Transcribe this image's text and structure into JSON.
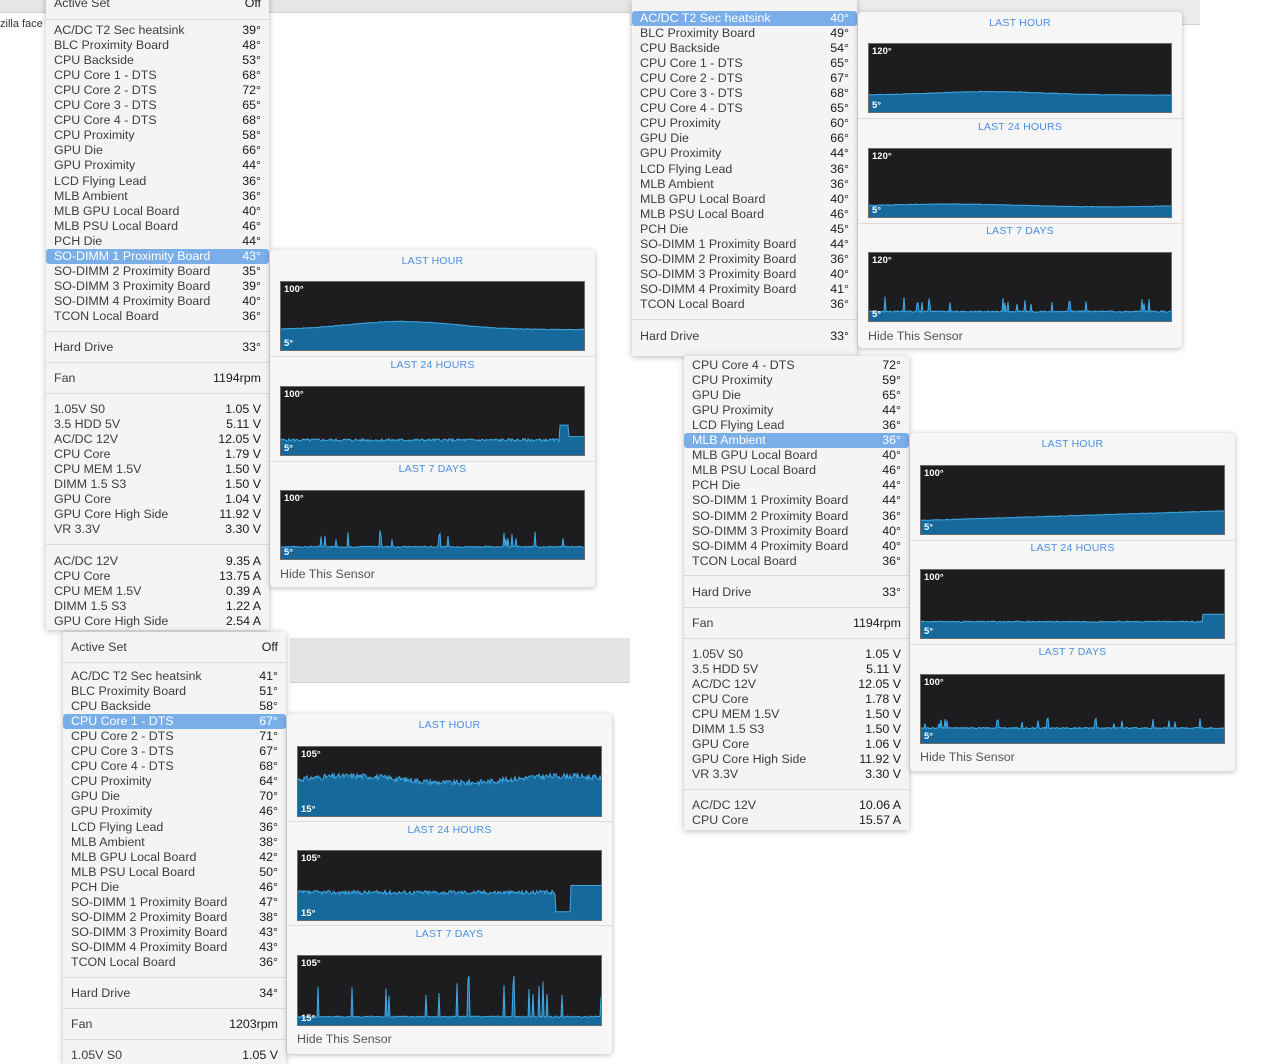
{
  "background": {
    "tab_fragment": "zilla face"
  },
  "menu_tl": {
    "header": {
      "label": "Active Set",
      "value": "Off"
    },
    "sensors": [
      {
        "label": "AC/DC T2 Sec heatsink",
        "value": "39°"
      },
      {
        "label": "BLC Proximity Board",
        "value": "48°"
      },
      {
        "label": "CPU Backside",
        "value": "53°"
      },
      {
        "label": "CPU Core 1 - DTS",
        "value": "68°"
      },
      {
        "label": "CPU Core 2 - DTS",
        "value": "72°"
      },
      {
        "label": "CPU Core 3 - DTS",
        "value": "65°"
      },
      {
        "label": "CPU Core 4 - DTS",
        "value": "68°"
      },
      {
        "label": "CPU Proximity",
        "value": "58°"
      },
      {
        "label": "GPU Die",
        "value": "66°"
      },
      {
        "label": "GPU Proximity",
        "value": "44°"
      },
      {
        "label": "LCD Flying Lead",
        "value": "36°"
      },
      {
        "label": "MLB Ambient",
        "value": "36°"
      },
      {
        "label": "MLB GPU Local Board",
        "value": "40°"
      },
      {
        "label": "MLB PSU Local Board",
        "value": "46°"
      },
      {
        "label": "PCH Die",
        "value": "44°"
      },
      {
        "label": "SO-DIMM 1 Proximity Board",
        "value": "43°"
      },
      {
        "label": "SO-DIMM 2 Proximity Board",
        "value": "35°"
      },
      {
        "label": "SO-DIMM 3 Proximity Board",
        "value": "39°"
      },
      {
        "label": "SO-DIMM 4 Proximity Board",
        "value": "40°"
      },
      {
        "label": "TCON Local Board",
        "value": "36°"
      }
    ],
    "drive": {
      "label": "Hard Drive",
      "value": "33°"
    },
    "fan": {
      "label": "Fan",
      "value": "1194rpm"
    },
    "voltages": [
      {
        "label": "1.05V S0",
        "value": "1.05 V"
      },
      {
        "label": "3.5 HDD 5V",
        "value": "5.11 V"
      },
      {
        "label": "AC/DC 12V",
        "value": "12.05 V"
      },
      {
        "label": "CPU Core",
        "value": "1.79 V"
      },
      {
        "label": "CPU MEM 1.5V",
        "value": "1.50 V"
      },
      {
        "label": "DIMM 1.5 S3",
        "value": "1.50 V"
      },
      {
        "label": "GPU Core",
        "value": "1.04 V"
      },
      {
        "label": "GPU Core High Side",
        "value": "11.92 V"
      },
      {
        "label": "VR 3.3V",
        "value": "3.30 V"
      }
    ],
    "currents": [
      {
        "label": "AC/DC 12V",
        "value": "9.35 A"
      },
      {
        "label": "CPU Core",
        "value": "13.75 A"
      },
      {
        "label": "CPU MEM 1.5V",
        "value": "0.39 A"
      },
      {
        "label": "DIMM 1.5 S3",
        "value": "1.22 A"
      },
      {
        "label": "GPU Core High Side",
        "value": "2.54 A"
      }
    ]
  },
  "menu_tr": {
    "sensors": [
      {
        "label": "AC/DC T2 Sec heatsink",
        "value": "40°"
      },
      {
        "label": "BLC Proximity Board",
        "value": "49°"
      },
      {
        "label": "CPU Backside",
        "value": "54°"
      },
      {
        "label": "CPU Core 1 - DTS",
        "value": "65°"
      },
      {
        "label": "CPU Core 2 - DTS",
        "value": "67°"
      },
      {
        "label": "CPU Core 3 - DTS",
        "value": "68°"
      },
      {
        "label": "CPU Core 4 - DTS",
        "value": "65°"
      },
      {
        "label": "CPU Proximity",
        "value": "60°"
      },
      {
        "label": "GPU Die",
        "value": "66°"
      },
      {
        "label": "GPU Proximity",
        "value": "44°"
      },
      {
        "label": "LCD Flying Lead",
        "value": "36°"
      },
      {
        "label": "MLB Ambient",
        "value": "36°"
      },
      {
        "label": "MLB GPU Local Board",
        "value": "40°"
      },
      {
        "label": "MLB PSU Local Board",
        "value": "46°"
      },
      {
        "label": "PCH Die",
        "value": "45°"
      },
      {
        "label": "SO-DIMM 1 Proximity Board",
        "value": "44°"
      },
      {
        "label": "SO-DIMM 2 Proximity Board",
        "value": "36°"
      },
      {
        "label": "SO-DIMM 3 Proximity Board",
        "value": "40°"
      },
      {
        "label": "SO-DIMM 4 Proximity Board",
        "value": "41°"
      },
      {
        "label": "TCON Local Board",
        "value": "36°"
      }
    ],
    "drive": {
      "label": "Hard Drive",
      "value": "33°"
    }
  },
  "menu_mr": {
    "sensors": [
      {
        "label": "CPU Core 4 - DTS",
        "value": "72°"
      },
      {
        "label": "CPU Proximity",
        "value": "59°"
      },
      {
        "label": "GPU Die",
        "value": "65°"
      },
      {
        "label": "GPU Proximity",
        "value": "44°"
      },
      {
        "label": "LCD Flying Lead",
        "value": "36°"
      },
      {
        "label": "MLB Ambient",
        "value": "36°"
      },
      {
        "label": "MLB GPU Local Board",
        "value": "40°"
      },
      {
        "label": "MLB PSU Local Board",
        "value": "46°"
      },
      {
        "label": "PCH Die",
        "value": "44°"
      },
      {
        "label": "SO-DIMM 1 Proximity Board",
        "value": "44°"
      },
      {
        "label": "SO-DIMM 2 Proximity Board",
        "value": "36°"
      },
      {
        "label": "SO-DIMM 3 Proximity Board",
        "value": "40°"
      },
      {
        "label": "SO-DIMM 4 Proximity Board",
        "value": "40°"
      },
      {
        "label": "TCON Local Board",
        "value": "36°"
      }
    ],
    "drive": {
      "label": "Hard Drive",
      "value": "33°"
    },
    "fan": {
      "label": "Fan",
      "value": "1194rpm"
    },
    "voltages": [
      {
        "label": "1.05V S0",
        "value": "1.05 V"
      },
      {
        "label": "3.5 HDD 5V",
        "value": "5.11 V"
      },
      {
        "label": "AC/DC 12V",
        "value": "12.05 V"
      },
      {
        "label": "CPU Core",
        "value": "1.78 V"
      },
      {
        "label": "CPU MEM 1.5V",
        "value": "1.50 V"
      },
      {
        "label": "DIMM 1.5 S3",
        "value": "1.50 V"
      },
      {
        "label": "GPU Core",
        "value": "1.06 V"
      },
      {
        "label": "GPU Core High Side",
        "value": "11.92 V"
      },
      {
        "label": "VR 3.3V",
        "value": "3.30 V"
      }
    ],
    "currents": [
      {
        "label": "AC/DC 12V",
        "value": "10.06 A"
      },
      {
        "label": "CPU Core",
        "value": "15.57 A"
      }
    ]
  },
  "menu_bl": {
    "header": {
      "label": "Active Set",
      "value": "Off"
    },
    "sensors": [
      {
        "label": "AC/DC T2 Sec heatsink",
        "value": "41°"
      },
      {
        "label": "BLC Proximity Board",
        "value": "51°"
      },
      {
        "label": "CPU Backside",
        "value": "58°"
      },
      {
        "label": "CPU Core 1 - DTS",
        "value": "67°"
      },
      {
        "label": "CPU Core 2 - DTS",
        "value": "71°"
      },
      {
        "label": "CPU Core 3 - DTS",
        "value": "67°"
      },
      {
        "label": "CPU Core 4 - DTS",
        "value": "68°"
      },
      {
        "label": "CPU Proximity",
        "value": "64°"
      },
      {
        "label": "GPU Die",
        "value": "70°"
      },
      {
        "label": "GPU Proximity",
        "value": "46°"
      },
      {
        "label": "LCD Flying Lead",
        "value": "36°"
      },
      {
        "label": "MLB Ambient",
        "value": "38°"
      },
      {
        "label": "MLB GPU Local Board",
        "value": "42°"
      },
      {
        "label": "MLB PSU Local Board",
        "value": "50°"
      },
      {
        "label": "PCH Die",
        "value": "46°"
      },
      {
        "label": "SO-DIMM 1 Proximity Board",
        "value": "47°"
      },
      {
        "label": "SO-DIMM 2 Proximity Board",
        "value": "38°"
      },
      {
        "label": "SO-DIMM 3 Proximity Board",
        "value": "43°"
      },
      {
        "label": "SO-DIMM 4 Proximity Board",
        "value": "43°"
      },
      {
        "label": "TCON Local Board",
        "value": "36°"
      }
    ],
    "drive": {
      "label": "Hard Drive",
      "value": "34°"
    },
    "fan": {
      "label": "Fan",
      "value": "1203rpm"
    },
    "voltages": [
      {
        "label": "1.05V S0",
        "value": "1.05 V"
      }
    ]
  },
  "graph_panels": {
    "titles": {
      "hour": "LAST HOUR",
      "day": "LAST 24 HOURS",
      "week": "LAST 7 DAYS"
    },
    "hide_label": "Hide This Sensor",
    "so_dimm1": {
      "max": "100°",
      "min": "5°"
    },
    "acdc_t2": {
      "max": "120°",
      "min": "5°"
    },
    "mlb_ambient": {
      "max": "100°",
      "min": "5°"
    },
    "cpu_core1": {
      "max": "105°",
      "min": "15°"
    }
  },
  "colors": {
    "selection": "#7aaee8",
    "graph_fill": "#16699a",
    "graph_line": "#3fa9e6",
    "graph_bg": "#1d1d1f",
    "title_blue": "#4a8ee0"
  }
}
